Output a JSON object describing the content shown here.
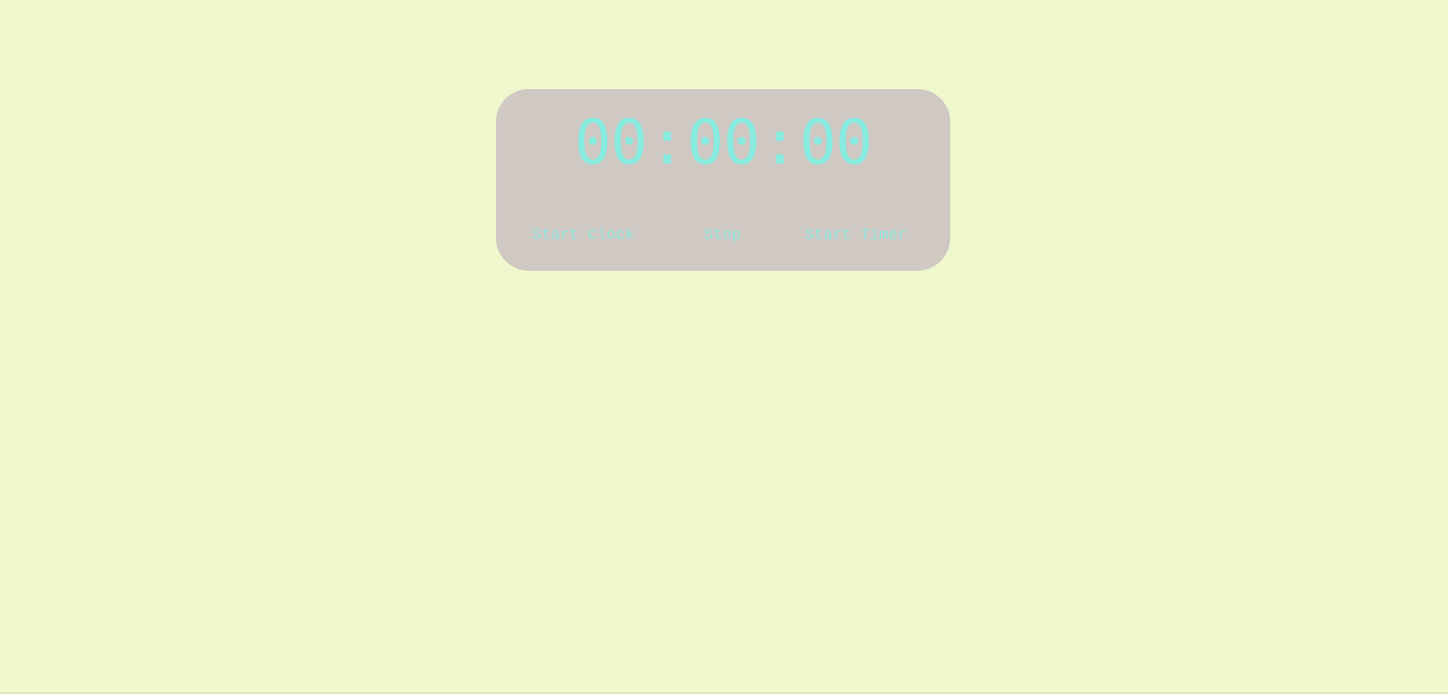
{
  "clock": {
    "hours": "00",
    "minutes": "00",
    "seconds": "00",
    "separator": ":"
  },
  "buttons": {
    "start_clock": "Start Clock",
    "stop": "Stop",
    "start_timer": "Start Timer"
  },
  "colors": {
    "background": "#eff8cc",
    "panel": "#cfc8c3",
    "digits": "#88ece0"
  }
}
